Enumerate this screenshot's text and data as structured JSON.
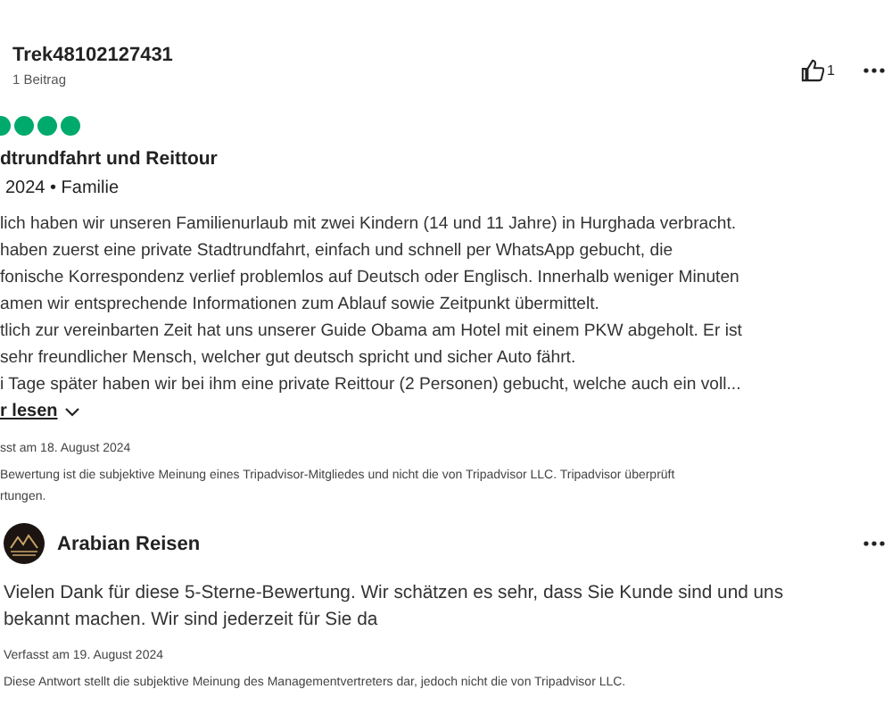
{
  "review": {
    "author": "Trek48102127431",
    "contributions": "1 Beitrag",
    "helpful_count": "1",
    "stars": 4,
    "title": "dtrundfahrt und Reittour",
    "meta": "2024 • Familie",
    "body_lines": [
      "lich haben wir unseren Familienurlaub mit zwei Kindern (14 und 11 Jahre) in Hurghada verbracht.",
      "haben zuerst eine private Stadtrundfahrt, einfach und schnell per WhatsApp gebucht, die",
      "fonische Korrespondenz verlief problemlos auf Deutsch oder Englisch. Innerhalb weniger Minuten",
      "amen wir entsprechende Informationen zum Ablauf sowie Zeitpunkt übermittelt.",
      "tlich zur vereinbarten Zeit hat uns unserer Guide Obama am Hotel mit einem PKW abgeholt. Er ist",
      "sehr freundlicher Mensch, welcher gut deutsch spricht und sicher Auto fährt.",
      "i Tage später haben wir bei ihm eine private Reittour (2 Personen) gebucht, welche auch ein voll..."
    ],
    "read_more": "r lesen",
    "written": "sst am 18. August 2024",
    "disclaimer_lines": [
      "Bewertung ist die subjektive Meinung eines Tripadvisor-Mitgliedes und nicht die von Tripadvisor LLC. Tripadvisor überprüft",
      "rtungen."
    ]
  },
  "response": {
    "author": "Arabian Reisen",
    "text": "Vielen Dank für diese 5-Sterne-Bewertung. Wir schätzen es sehr, dass Sie Kunde sind und uns bekannt machen. Wir sind jederzeit für Sie da",
    "written": "Verfasst am 19. August 2024",
    "disclaimer": "Diese Antwort stellt die subjektive Meinung des Managementvertreters dar, jedoch nicht die von Tripadvisor LLC."
  }
}
